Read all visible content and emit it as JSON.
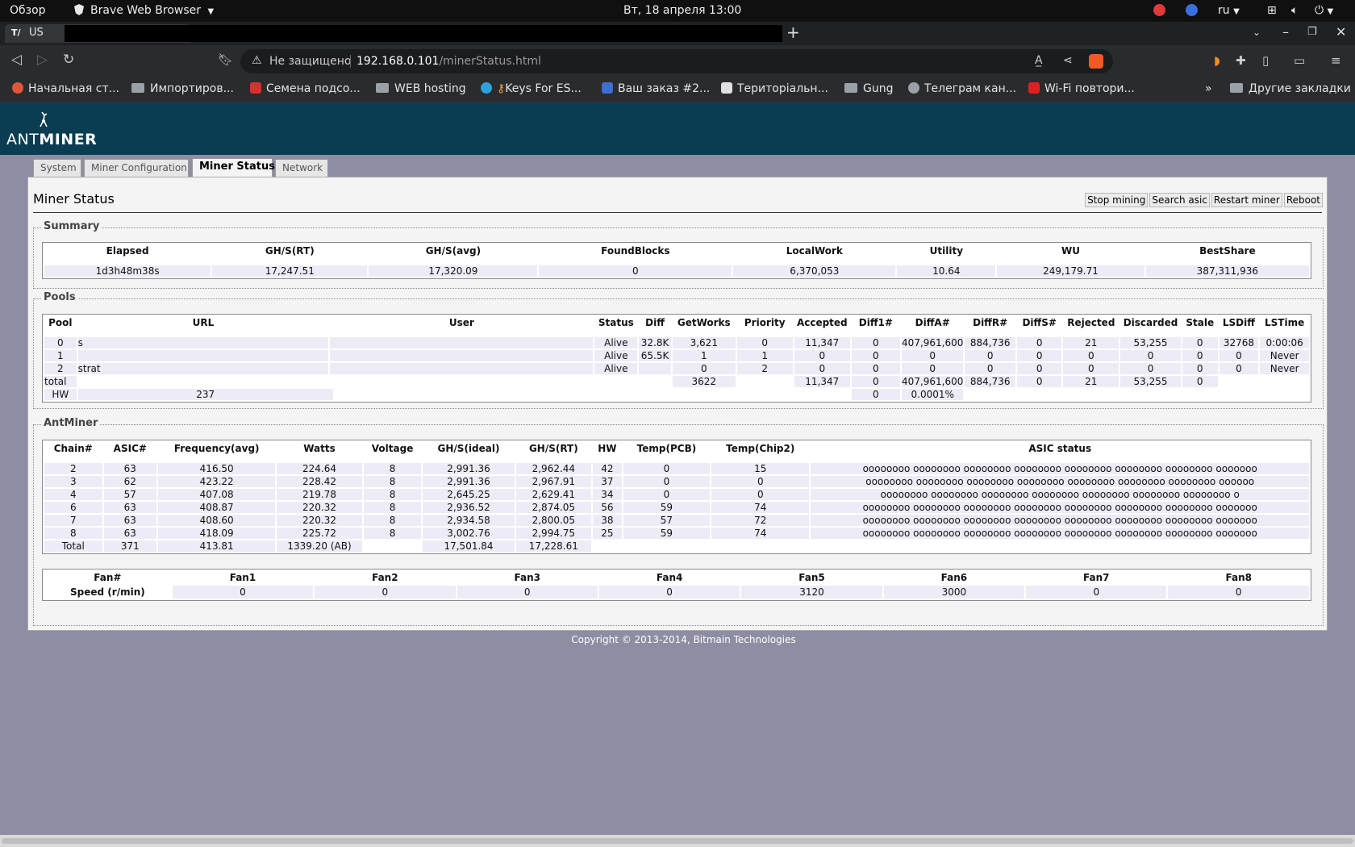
{
  "topbar": {
    "overview": "Обзор",
    "app_name": "Brave Web Browser",
    "datetime": "Вт, 18 апреля  13:00",
    "lang": "ru"
  },
  "tab": {
    "favicon": "T/",
    "title": "US"
  },
  "toolbar": {
    "security": "Не защищено",
    "url_host": "192.168.0.101",
    "url_path": "/minerStatus.html"
  },
  "bookmarks": [
    {
      "label": "Начальная ст...",
      "icon": "brave-icon",
      "color": "#e0563a"
    },
    {
      "label": "Импортиров...",
      "icon": "folder-icon"
    },
    {
      "label": "Семена подсо...",
      "icon": "bars-icon",
      "color": "#d83030"
    },
    {
      "label": "WEB hosting",
      "icon": "folder-icon"
    },
    {
      "label": "Keys For ES...",
      "icon": "telegram-icon",
      "color": "#2aa3de"
    },
    {
      "label": "Ваш заказ #2...",
      "icon": "superman-icon",
      "color": "#3c6fd0"
    },
    {
      "label": "Територіальн...",
      "icon": "shield-icon",
      "color": "#e0e0e0"
    },
    {
      "label": "Gung",
      "icon": "folder-icon"
    },
    {
      "label": "Телеграм кан...",
      "icon": "globe-icon",
      "color": "#9aa0a6"
    },
    {
      "label": "Wi-Fi повтори...",
      "icon": "youtube-icon",
      "color": "#e02020"
    }
  ],
  "bookmarks_more": "»",
  "bookmarks_other": "Другие закладки",
  "brand": {
    "ant": "ANT",
    "miner": "MINER"
  },
  "nav_tabs": [
    "System",
    "Miner Configuration",
    "Miner Status",
    "Network"
  ],
  "page_title": "Miner Status",
  "actions": [
    "Stop mining",
    "Search asic",
    "Restart miner",
    "Reboot"
  ],
  "summary": {
    "legend": "Summary",
    "headers": [
      "Elapsed",
      "GH/S(RT)",
      "GH/S(avg)",
      "FoundBlocks",
      "LocalWork",
      "Utility",
      "WU",
      "BestShare"
    ],
    "values": [
      "1d3h48m38s",
      "17,247.51",
      "17,320.09",
      "0",
      "6,370,053",
      "10.64",
      "249,179.71",
      "387,311,936"
    ]
  },
  "pools": {
    "legend": "Pools",
    "headers": [
      "Pool",
      "URL",
      "User",
      "Status",
      "Diff",
      "GetWorks",
      "Priority",
      "Accepted",
      "Diff1#",
      "DiffA#",
      "DiffR#",
      "DiffS#",
      "Rejected",
      "Discarded",
      "Stale",
      "LSDiff",
      "LSTime"
    ],
    "rows": [
      [
        "0",
        "s",
        "",
        "Alive",
        "32.8K",
        "3,621",
        "0",
        "11,347",
        "0",
        "407,961,600",
        "884,736",
        "0",
        "21",
        "53,255",
        "0",
        "32768",
        "0:00:06"
      ],
      [
        "1",
        "",
        "",
        "Alive",
        "65.5K",
        "1",
        "1",
        "0",
        "0",
        "0",
        "0",
        "0",
        "0",
        "0",
        "0",
        "0",
        "Never"
      ],
      [
        "2",
        "strat",
        "",
        "Alive",
        "",
        "0",
        "2",
        "0",
        "0",
        "0",
        "0",
        "0",
        "0",
        "0",
        "0",
        "0",
        "Never"
      ]
    ],
    "total": [
      "total",
      "",
      "",
      "",
      "",
      "3622",
      "",
      "11,347",
      "0",
      "407,961,600",
      "884,736",
      "0",
      "21",
      "53,255",
      "0",
      "",
      ""
    ],
    "hw_label": "HW",
    "hw_value": "237",
    "hw_diff1": "0",
    "hw_pct": "0.0001%"
  },
  "antminer": {
    "legend": "AntMiner",
    "headers": [
      "Chain#",
      "ASIC#",
      "Frequency(avg)",
      "Watts",
      "Voltage",
      "GH/S(ideal)",
      "GH/S(RT)",
      "HW",
      "Temp(PCB)",
      "Temp(Chip2)",
      "ASIC status"
    ],
    "rows": [
      [
        "2",
        "63",
        "416.50",
        "224.64",
        "8",
        "2,991.36",
        "2,962.44",
        "42",
        "0",
        "15",
        "oooooooo oooooooo oooooooo oooooooo oooooooo oooooooo oooooooo ooooooo"
      ],
      [
        "3",
        "62",
        "423.22",
        "228.42",
        "8",
        "2,991.36",
        "2,967.91",
        "37",
        "0",
        "0",
        "oooooooo oooooooo oooooooo oooooooo oooooooo oooooooo oooooooo oooooo"
      ],
      [
        "4",
        "57",
        "407.08",
        "219.78",
        "8",
        "2,645.25",
        "2,629.41",
        "34",
        "0",
        "0",
        "oooooooo oooooooo oooooooo oooooooo oooooooo oooooooo oooooooo o"
      ],
      [
        "6",
        "63",
        "408.87",
        "220.32",
        "8",
        "2,936.52",
        "2,874.05",
        "56",
        "59",
        "74",
        "oooooooo oooooooo oooooooo oooooooo oooooooo oooooooo oooooooo ooooooo"
      ],
      [
        "7",
        "63",
        "408.60",
        "220.32",
        "8",
        "2,934.58",
        "2,800.05",
        "38",
        "57",
        "72",
        "oooooooo oooooooo oooooooo oooooooo oooooooo oooooooo oooooooo ooooooo"
      ],
      [
        "8",
        "63",
        "418.09",
        "225.72",
        "8",
        "3,002.76",
        "2,994.75",
        "25",
        "59",
        "74",
        "oooooooo oooooooo oooooooo oooooooo oooooooo oooooooo oooooooo ooooooo"
      ]
    ],
    "total": [
      "Total",
      "371",
      "413.81",
      "1339.20 (AB)",
      "",
      "17,501.84",
      "17,228.61"
    ]
  },
  "fans": {
    "headers": [
      "Fan#",
      "Fan1",
      "Fan2",
      "Fan3",
      "Fan4",
      "Fan5",
      "Fan6",
      "Fan7",
      "Fan8"
    ],
    "values": [
      "Speed (r/min)",
      "0",
      "0",
      "0",
      "0",
      "3120",
      "3000",
      "0",
      "0"
    ]
  },
  "copyright": "Copyright © 2013-2014, Bitmain Technologies"
}
